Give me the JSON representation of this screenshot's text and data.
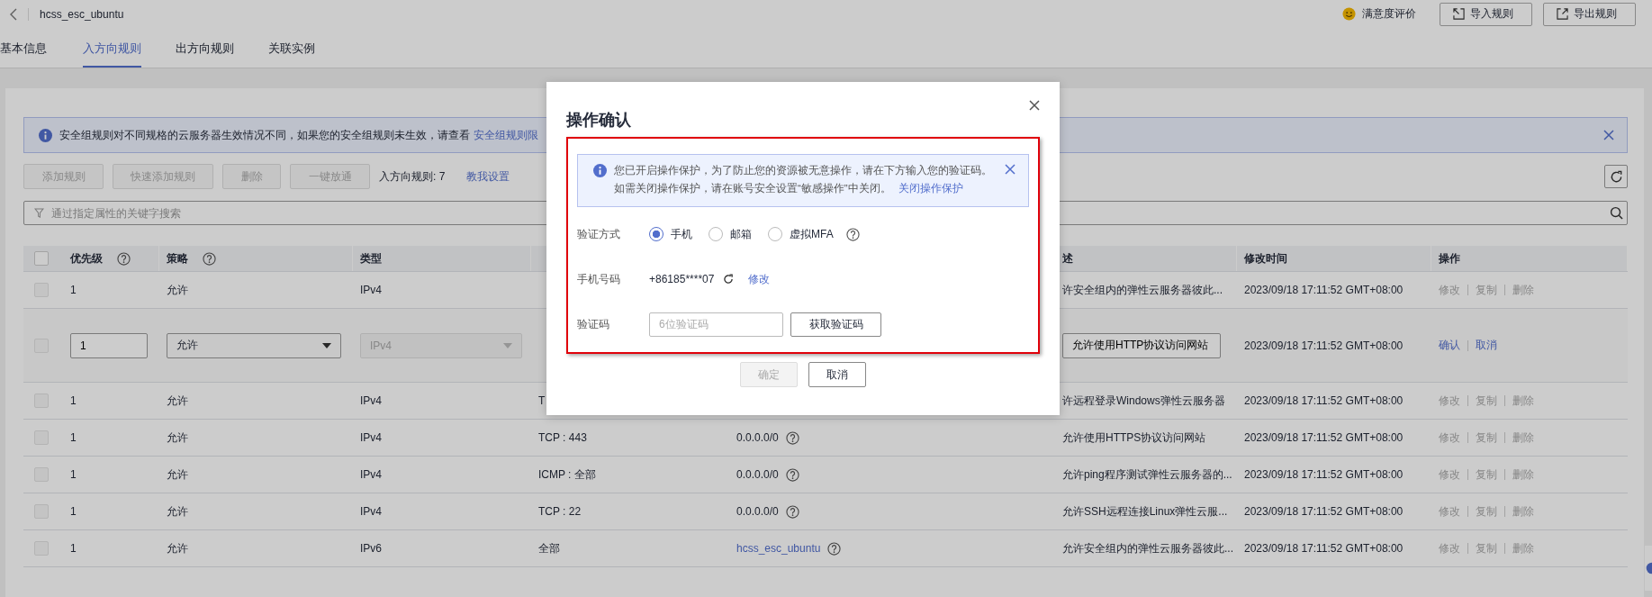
{
  "header": {
    "title": "hcss_esc_ubuntu",
    "feedback": "满意度评价",
    "buttons": [
      {
        "label": "导入规则",
        "kind": "import"
      },
      {
        "label": "导出规则",
        "kind": "export"
      }
    ]
  },
  "tabs": [
    {
      "label": "基本信息",
      "selected": false
    },
    {
      "label": "入方向规则",
      "selected": true
    },
    {
      "label": "出方向规则",
      "selected": false
    },
    {
      "label": "关联实例",
      "selected": false
    }
  ],
  "notice": {
    "text": "安全组规则对不同规格的云服务器生效情况不同，如果您的安全组规则未生效，请查看",
    "link": "安全组规则限"
  },
  "toolbar": {
    "buttons": [
      {
        "label": "添加规则",
        "disabled": true
      },
      {
        "label": "快速添加规则",
        "disabled": true
      },
      {
        "label": "删除",
        "disabled": true
      },
      {
        "label": "一键放通",
        "disabled": true
      }
    ],
    "count": "入方向规则: 7",
    "help_link": "教我设置"
  },
  "search": {
    "placeholder": "通过指定属性的关键字搜索"
  },
  "table": {
    "header_checked": false,
    "columns": {
      "priority": {
        "label": "优先级",
        "help": true
      },
      "policy": {
        "label": "策略",
        "help": true
      },
      "type": {
        "label": "类型",
        "help": false
      },
      "description": {
        "label": "述",
        "help": false
      },
      "modified": {
        "label": "修改时间",
        "help": false
      },
      "operations": {
        "label": "操作",
        "help": false
      }
    },
    "rows": [
      {
        "kind": "view",
        "checked": false,
        "priority": "1",
        "policy": "允许",
        "type": "IPv4",
        "description": "许安全组内的弹性云服务器彼此...",
        "modified": "2023/09/18 17:11:52 GMT+08:00",
        "operations": [
          {
            "label": "修改",
            "disabled": true
          },
          {
            "label": "复制",
            "disabled": true
          },
          {
            "label": "删除",
            "disabled": true
          }
        ]
      },
      {
        "kind": "edit",
        "checked": false,
        "priority": "1",
        "policy": "允许",
        "type": "IPv4",
        "type_disabled": true,
        "description": "允许使用HTTP协议访问网站",
        "modified": "2023/09/18 17:11:52 GMT+08:00",
        "operations": [
          {
            "label": "确认",
            "disabled": false
          },
          {
            "label": "取消",
            "disabled": false
          }
        ]
      },
      {
        "kind": "view",
        "checked": false,
        "priority": "1",
        "policy": "允许",
        "type": "IPv4",
        "column_4": "T",
        "description": "许远程登录Windows弹性云服务器",
        "modified": "2023/09/18 17:11:52 GMT+08:00",
        "operations": [
          {
            "label": "修改",
            "disabled": true
          },
          {
            "label": "复制",
            "disabled": true
          },
          {
            "label": "删除",
            "disabled": true
          }
        ]
      },
      {
        "kind": "view",
        "checked": false,
        "priority": "1",
        "policy": "允许",
        "type": "IPv4",
        "column_4": "TCP : 443",
        "source": {
          "text": "0.0.0.0/0",
          "link": false,
          "help": true
        },
        "description": "允许使用HTTPS协议访问网站",
        "modified": "2023/09/18 17:11:52 GMT+08:00",
        "operations": [
          {
            "label": "修改",
            "disabled": true
          },
          {
            "label": "复制",
            "disabled": true
          },
          {
            "label": "删除",
            "disabled": true
          }
        ]
      },
      {
        "kind": "view",
        "checked": false,
        "priority": "1",
        "policy": "允许",
        "type": "IPv4",
        "column_4": "ICMP : 全部",
        "source": {
          "text": "0.0.0.0/0",
          "link": false,
          "help": true
        },
        "description": "允许ping程序测试弹性云服务器的...",
        "modified": "2023/09/18 17:11:52 GMT+08:00",
        "operations": [
          {
            "label": "修改",
            "disabled": true
          },
          {
            "label": "复制",
            "disabled": true
          },
          {
            "label": "删除",
            "disabled": true
          }
        ]
      },
      {
        "kind": "view",
        "checked": false,
        "priority": "1",
        "policy": "允许",
        "type": "IPv4",
        "column_4": "TCP : 22",
        "source": {
          "text": "0.0.0.0/0",
          "link": false,
          "help": true
        },
        "description": "允许SSH远程连接Linux弹性云服...",
        "modified": "2023/09/18 17:11:52 GMT+08:00",
        "operations": [
          {
            "label": "修改",
            "disabled": true
          },
          {
            "label": "复制",
            "disabled": true
          },
          {
            "label": "删除",
            "disabled": true
          }
        ]
      },
      {
        "kind": "view",
        "checked": false,
        "priority": "1",
        "policy": "允许",
        "type": "IPv6",
        "column_4": "全部",
        "source": {
          "text": "hcss_esc_ubuntu",
          "link": true,
          "help": true
        },
        "description": "允许安全组内的弹性云服务器彼此...",
        "modified": "2023/09/18 17:11:52 GMT+08:00",
        "operations": [
          {
            "label": "修改",
            "disabled": true
          },
          {
            "label": "复制",
            "disabled": true
          },
          {
            "label": "删除",
            "disabled": true
          }
        ]
      }
    ]
  },
  "dialog": {
    "title": "操作确认",
    "highlighted": true,
    "notice": {
      "text": "您已开启操作保护，为了防止您的资源被无意操作，请在下方输入您的验证码。",
      "text_2": "如需关闭操作保护，请在账号安全设置“敏感操作”中关闭。",
      "link": "关闭操作保护"
    },
    "method": {
      "label": "验证方式",
      "options": [
        {
          "label": "手机",
          "selected": true
        },
        {
          "label": "邮箱",
          "selected": false
        },
        {
          "label": "虚拟MFA",
          "selected": false
        }
      ]
    },
    "phone": {
      "label": "手机号码",
      "value": "+86185****07",
      "link": "修改"
    },
    "code": {
      "label": "验证码",
      "placeholder": "6位验证码",
      "button": "获取验证码"
    },
    "buttons": [
      {
        "label": "确定",
        "disabled": true
      },
      {
        "label": "取消",
        "disabled": false
      }
    ]
  }
}
